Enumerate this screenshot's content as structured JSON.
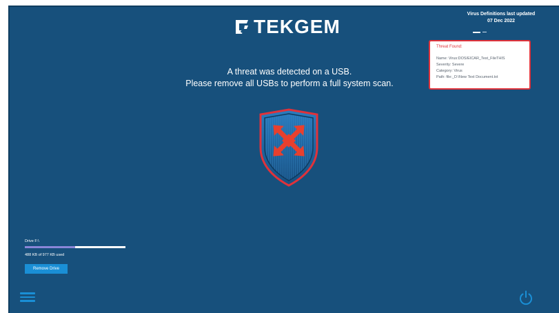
{
  "brand": {
    "name": "TEKGEM"
  },
  "definitions": {
    "line1": "Virus Definitions last updated",
    "line2": "07 Dec 2022"
  },
  "threat": {
    "title": "Threat Found:",
    "name": "Name: Virus:DOS/EICAR_Test_FileTHIS",
    "severity": "Severity: Severe",
    "category": "Category: Virus",
    "path": "Path: file:_D:\\New Text Document.txt"
  },
  "message": {
    "line1": "A threat was detected on a USB.",
    "line2": "Please remove all USBs to perform a full system scan."
  },
  "drive": {
    "label": "Drive F:\\",
    "usage": "488 KB of 977 KB used",
    "used_fraction": 0.5,
    "remove_label": "Remove Drive"
  },
  "icons": {
    "logo": "tekgem-logo-icon",
    "shield": "threat-shield-icon",
    "menu": "hamburger-menu-icon",
    "power": "power-icon"
  },
  "colors": {
    "background": "#17507c",
    "accent": "#1a8fd6",
    "alert": "#e0323a",
    "shield_fill": "#1f6aa5"
  }
}
